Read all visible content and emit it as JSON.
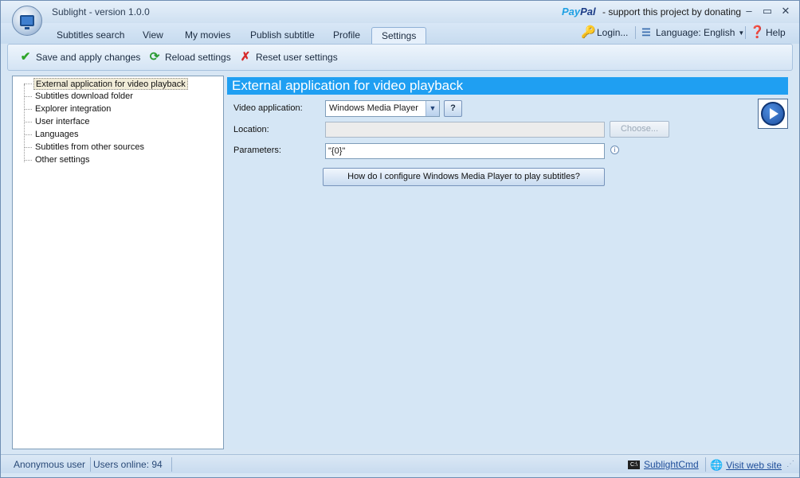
{
  "window": {
    "title": "Sublight - version 1.0.0",
    "paypal_brand": [
      "Pay",
      "Pal"
    ],
    "donate_text": "- support this project by donating",
    "controls": {
      "minimize": "–",
      "maximize": "▭",
      "close": "✕"
    }
  },
  "tabs": [
    {
      "label": "Subtitles search"
    },
    {
      "label": "View"
    },
    {
      "label": "My movies"
    },
    {
      "label": "Publish subtitle"
    },
    {
      "label": "Profile"
    },
    {
      "label": "Settings",
      "active": true
    }
  ],
  "header_tools": {
    "login": "Login...",
    "language": "Language: English",
    "help": "Help"
  },
  "ribbon": {
    "save": "Save and apply changes",
    "reload": "Reload settings",
    "reset": "Reset user settings"
  },
  "tree": {
    "items": [
      {
        "label": "External application for video playback",
        "selected": true
      },
      {
        "label": "Subtitles download folder"
      },
      {
        "label": "Explorer integration"
      },
      {
        "label": "User interface"
      },
      {
        "label": "Languages"
      },
      {
        "label": "Subtitles from other sources"
      },
      {
        "label": "Other settings"
      }
    ]
  },
  "panel": {
    "title": "External application for video playback",
    "video_app_label": "Video application:",
    "video_app_value": "Windows Media Player",
    "help_button": "?",
    "location_label": "Location:",
    "location_value": "",
    "choose_button": "Choose...",
    "parameters_label": "Parameters:",
    "parameters_value": "\"{0}\"",
    "info_icon": "i",
    "howto_button": "How do I configure Windows Media Player to play subtitles?"
  },
  "status": {
    "user": "Anonymous user",
    "online": "Users online: 94",
    "cmd": "SublightCmd",
    "website": "Visit web site"
  },
  "colors": {
    "header_blue": "#1f9ff2",
    "window_bg": "#d7e6f4"
  }
}
